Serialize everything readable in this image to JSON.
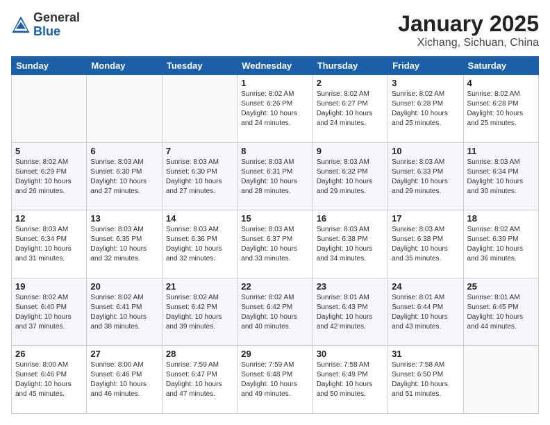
{
  "header": {
    "logo_line1": "General",
    "logo_line2": "Blue",
    "title": "January 2025",
    "subtitle": "Xichang, Sichuan, China"
  },
  "days_of_week": [
    "Sunday",
    "Monday",
    "Tuesday",
    "Wednesday",
    "Thursday",
    "Friday",
    "Saturday"
  ],
  "weeks": [
    [
      {
        "day": "",
        "text": ""
      },
      {
        "day": "",
        "text": ""
      },
      {
        "day": "",
        "text": ""
      },
      {
        "day": "1",
        "text": "Sunrise: 8:02 AM\nSunset: 6:26 PM\nDaylight: 10 hours\nand 24 minutes."
      },
      {
        "day": "2",
        "text": "Sunrise: 8:02 AM\nSunset: 6:27 PM\nDaylight: 10 hours\nand 24 minutes."
      },
      {
        "day": "3",
        "text": "Sunrise: 8:02 AM\nSunset: 6:28 PM\nDaylight: 10 hours\nand 25 minutes."
      },
      {
        "day": "4",
        "text": "Sunrise: 8:02 AM\nSunset: 6:28 PM\nDaylight: 10 hours\nand 25 minutes."
      }
    ],
    [
      {
        "day": "5",
        "text": "Sunrise: 8:02 AM\nSunset: 6:29 PM\nDaylight: 10 hours\nand 26 minutes."
      },
      {
        "day": "6",
        "text": "Sunrise: 8:03 AM\nSunset: 6:30 PM\nDaylight: 10 hours\nand 27 minutes."
      },
      {
        "day": "7",
        "text": "Sunrise: 8:03 AM\nSunset: 6:30 PM\nDaylight: 10 hours\nand 27 minutes."
      },
      {
        "day": "8",
        "text": "Sunrise: 8:03 AM\nSunset: 6:31 PM\nDaylight: 10 hours\nand 28 minutes."
      },
      {
        "day": "9",
        "text": "Sunrise: 8:03 AM\nSunset: 6:32 PM\nDaylight: 10 hours\nand 29 minutes."
      },
      {
        "day": "10",
        "text": "Sunrise: 8:03 AM\nSunset: 6:33 PM\nDaylight: 10 hours\nand 29 minutes."
      },
      {
        "day": "11",
        "text": "Sunrise: 8:03 AM\nSunset: 6:34 PM\nDaylight: 10 hours\nand 30 minutes."
      }
    ],
    [
      {
        "day": "12",
        "text": "Sunrise: 8:03 AM\nSunset: 6:34 PM\nDaylight: 10 hours\nand 31 minutes."
      },
      {
        "day": "13",
        "text": "Sunrise: 8:03 AM\nSunset: 6:35 PM\nDaylight: 10 hours\nand 32 minutes."
      },
      {
        "day": "14",
        "text": "Sunrise: 8:03 AM\nSunset: 6:36 PM\nDaylight: 10 hours\nand 32 minutes."
      },
      {
        "day": "15",
        "text": "Sunrise: 8:03 AM\nSunset: 6:37 PM\nDaylight: 10 hours\nand 33 minutes."
      },
      {
        "day": "16",
        "text": "Sunrise: 8:03 AM\nSunset: 6:38 PM\nDaylight: 10 hours\nand 34 minutes."
      },
      {
        "day": "17",
        "text": "Sunrise: 8:03 AM\nSunset: 6:38 PM\nDaylight: 10 hours\nand 35 minutes."
      },
      {
        "day": "18",
        "text": "Sunrise: 8:02 AM\nSunset: 6:39 PM\nDaylight: 10 hours\nand 36 minutes."
      }
    ],
    [
      {
        "day": "19",
        "text": "Sunrise: 8:02 AM\nSunset: 6:40 PM\nDaylight: 10 hours\nand 37 minutes."
      },
      {
        "day": "20",
        "text": "Sunrise: 8:02 AM\nSunset: 6:41 PM\nDaylight: 10 hours\nand 38 minutes."
      },
      {
        "day": "21",
        "text": "Sunrise: 8:02 AM\nSunset: 6:42 PM\nDaylight: 10 hours\nand 39 minutes."
      },
      {
        "day": "22",
        "text": "Sunrise: 8:02 AM\nSunset: 6:42 PM\nDaylight: 10 hours\nand 40 minutes."
      },
      {
        "day": "23",
        "text": "Sunrise: 8:01 AM\nSunset: 6:43 PM\nDaylight: 10 hours\nand 42 minutes."
      },
      {
        "day": "24",
        "text": "Sunrise: 8:01 AM\nSunset: 6:44 PM\nDaylight: 10 hours\nand 43 minutes."
      },
      {
        "day": "25",
        "text": "Sunrise: 8:01 AM\nSunset: 6:45 PM\nDaylight: 10 hours\nand 44 minutes."
      }
    ],
    [
      {
        "day": "26",
        "text": "Sunrise: 8:00 AM\nSunset: 6:46 PM\nDaylight: 10 hours\nand 45 minutes."
      },
      {
        "day": "27",
        "text": "Sunrise: 8:00 AM\nSunset: 6:46 PM\nDaylight: 10 hours\nand 46 minutes."
      },
      {
        "day": "28",
        "text": "Sunrise: 7:59 AM\nSunset: 6:47 PM\nDaylight: 10 hours\nand 47 minutes."
      },
      {
        "day": "29",
        "text": "Sunrise: 7:59 AM\nSunset: 6:48 PM\nDaylight: 10 hours\nand 49 minutes."
      },
      {
        "day": "30",
        "text": "Sunrise: 7:58 AM\nSunset: 6:49 PM\nDaylight: 10 hours\nand 50 minutes."
      },
      {
        "day": "31",
        "text": "Sunrise: 7:58 AM\nSunset: 6:50 PM\nDaylight: 10 hours\nand 51 minutes."
      },
      {
        "day": "",
        "text": ""
      }
    ]
  ]
}
